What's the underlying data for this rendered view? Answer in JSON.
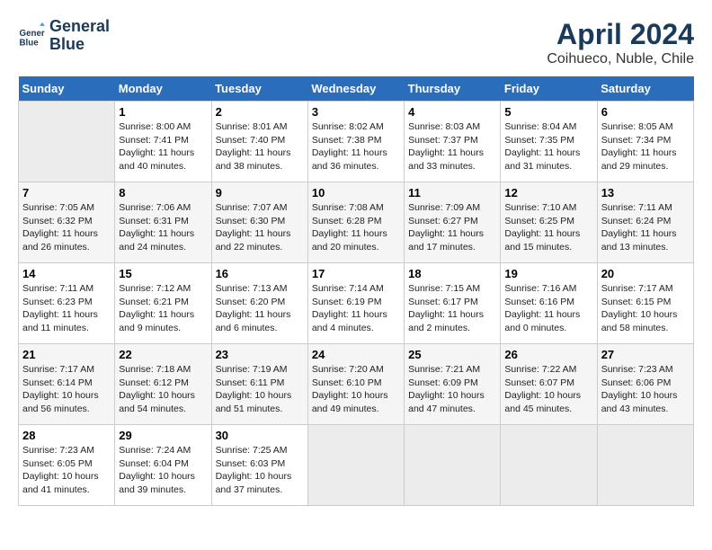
{
  "header": {
    "logo_line1": "General",
    "logo_line2": "Blue",
    "title": "April 2024",
    "subtitle": "Coihueco, Nuble, Chile"
  },
  "weekdays": [
    "Sunday",
    "Monday",
    "Tuesday",
    "Wednesday",
    "Thursday",
    "Friday",
    "Saturday"
  ],
  "weeks": [
    [
      {
        "day": "",
        "sunrise": "",
        "sunset": "",
        "daylight": "",
        "empty": true
      },
      {
        "day": "1",
        "sunrise": "Sunrise: 8:00 AM",
        "sunset": "Sunset: 7:41 PM",
        "daylight": "Daylight: 11 hours and 40 minutes."
      },
      {
        "day": "2",
        "sunrise": "Sunrise: 8:01 AM",
        "sunset": "Sunset: 7:40 PM",
        "daylight": "Daylight: 11 hours and 38 minutes."
      },
      {
        "day": "3",
        "sunrise": "Sunrise: 8:02 AM",
        "sunset": "Sunset: 7:38 PM",
        "daylight": "Daylight: 11 hours and 36 minutes."
      },
      {
        "day": "4",
        "sunrise": "Sunrise: 8:03 AM",
        "sunset": "Sunset: 7:37 PM",
        "daylight": "Daylight: 11 hours and 33 minutes."
      },
      {
        "day": "5",
        "sunrise": "Sunrise: 8:04 AM",
        "sunset": "Sunset: 7:35 PM",
        "daylight": "Daylight: 11 hours and 31 minutes."
      },
      {
        "day": "6",
        "sunrise": "Sunrise: 8:05 AM",
        "sunset": "Sunset: 7:34 PM",
        "daylight": "Daylight: 11 hours and 29 minutes."
      }
    ],
    [
      {
        "day": "7",
        "sunrise": "Sunrise: 7:05 AM",
        "sunset": "Sunset: 6:32 PM",
        "daylight": "Daylight: 11 hours and 26 minutes."
      },
      {
        "day": "8",
        "sunrise": "Sunrise: 7:06 AM",
        "sunset": "Sunset: 6:31 PM",
        "daylight": "Daylight: 11 hours and 24 minutes."
      },
      {
        "day": "9",
        "sunrise": "Sunrise: 7:07 AM",
        "sunset": "Sunset: 6:30 PM",
        "daylight": "Daylight: 11 hours and 22 minutes."
      },
      {
        "day": "10",
        "sunrise": "Sunrise: 7:08 AM",
        "sunset": "Sunset: 6:28 PM",
        "daylight": "Daylight: 11 hours and 20 minutes."
      },
      {
        "day": "11",
        "sunrise": "Sunrise: 7:09 AM",
        "sunset": "Sunset: 6:27 PM",
        "daylight": "Daylight: 11 hours and 17 minutes."
      },
      {
        "day": "12",
        "sunrise": "Sunrise: 7:10 AM",
        "sunset": "Sunset: 6:25 PM",
        "daylight": "Daylight: 11 hours and 15 minutes."
      },
      {
        "day": "13",
        "sunrise": "Sunrise: 7:11 AM",
        "sunset": "Sunset: 6:24 PM",
        "daylight": "Daylight: 11 hours and 13 minutes."
      }
    ],
    [
      {
        "day": "14",
        "sunrise": "Sunrise: 7:11 AM",
        "sunset": "Sunset: 6:23 PM",
        "daylight": "Daylight: 11 hours and 11 minutes."
      },
      {
        "day": "15",
        "sunrise": "Sunrise: 7:12 AM",
        "sunset": "Sunset: 6:21 PM",
        "daylight": "Daylight: 11 hours and 9 minutes."
      },
      {
        "day": "16",
        "sunrise": "Sunrise: 7:13 AM",
        "sunset": "Sunset: 6:20 PM",
        "daylight": "Daylight: 11 hours and 6 minutes."
      },
      {
        "day": "17",
        "sunrise": "Sunrise: 7:14 AM",
        "sunset": "Sunset: 6:19 PM",
        "daylight": "Daylight: 11 hours and 4 minutes."
      },
      {
        "day": "18",
        "sunrise": "Sunrise: 7:15 AM",
        "sunset": "Sunset: 6:17 PM",
        "daylight": "Daylight: 11 hours and 2 minutes."
      },
      {
        "day": "19",
        "sunrise": "Sunrise: 7:16 AM",
        "sunset": "Sunset: 6:16 PM",
        "daylight": "Daylight: 11 hours and 0 minutes."
      },
      {
        "day": "20",
        "sunrise": "Sunrise: 7:17 AM",
        "sunset": "Sunset: 6:15 PM",
        "daylight": "Daylight: 10 hours and 58 minutes."
      }
    ],
    [
      {
        "day": "21",
        "sunrise": "Sunrise: 7:17 AM",
        "sunset": "Sunset: 6:14 PM",
        "daylight": "Daylight: 10 hours and 56 minutes."
      },
      {
        "day": "22",
        "sunrise": "Sunrise: 7:18 AM",
        "sunset": "Sunset: 6:12 PM",
        "daylight": "Daylight: 10 hours and 54 minutes."
      },
      {
        "day": "23",
        "sunrise": "Sunrise: 7:19 AM",
        "sunset": "Sunset: 6:11 PM",
        "daylight": "Daylight: 10 hours and 51 minutes."
      },
      {
        "day": "24",
        "sunrise": "Sunrise: 7:20 AM",
        "sunset": "Sunset: 6:10 PM",
        "daylight": "Daylight: 10 hours and 49 minutes."
      },
      {
        "day": "25",
        "sunrise": "Sunrise: 7:21 AM",
        "sunset": "Sunset: 6:09 PM",
        "daylight": "Daylight: 10 hours and 47 minutes."
      },
      {
        "day": "26",
        "sunrise": "Sunrise: 7:22 AM",
        "sunset": "Sunset: 6:07 PM",
        "daylight": "Daylight: 10 hours and 45 minutes."
      },
      {
        "day": "27",
        "sunrise": "Sunrise: 7:23 AM",
        "sunset": "Sunset: 6:06 PM",
        "daylight": "Daylight: 10 hours and 43 minutes."
      }
    ],
    [
      {
        "day": "28",
        "sunrise": "Sunrise: 7:23 AM",
        "sunset": "Sunset: 6:05 PM",
        "daylight": "Daylight: 10 hours and 41 minutes."
      },
      {
        "day": "29",
        "sunrise": "Sunrise: 7:24 AM",
        "sunset": "Sunset: 6:04 PM",
        "daylight": "Daylight: 10 hours and 39 minutes."
      },
      {
        "day": "30",
        "sunrise": "Sunrise: 7:25 AM",
        "sunset": "Sunset: 6:03 PM",
        "daylight": "Daylight: 10 hours and 37 minutes."
      },
      {
        "day": "",
        "sunrise": "",
        "sunset": "",
        "daylight": "",
        "empty": true
      },
      {
        "day": "",
        "sunrise": "",
        "sunset": "",
        "daylight": "",
        "empty": true
      },
      {
        "day": "",
        "sunrise": "",
        "sunset": "",
        "daylight": "",
        "empty": true
      },
      {
        "day": "",
        "sunrise": "",
        "sunset": "",
        "daylight": "",
        "empty": true
      }
    ]
  ]
}
